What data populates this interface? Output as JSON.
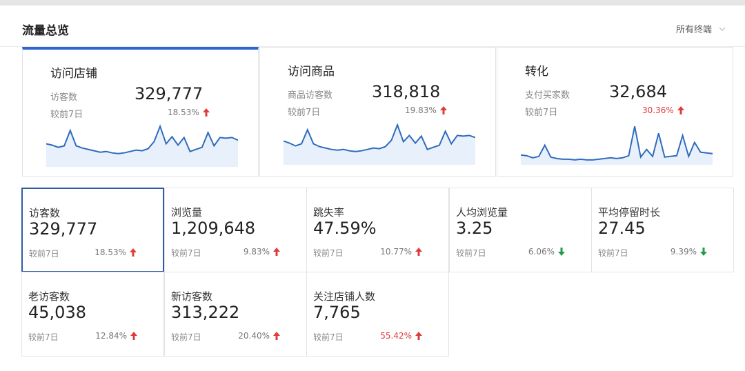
{
  "header": {
    "title": "流量总览",
    "filter_value": "所有终端"
  },
  "colors": {
    "accent": "#2e67d1",
    "up": "#e03b3b",
    "down": "#23994a",
    "chart_line": "#2f6bbd",
    "chart_fill": "#e8f0fb"
  },
  "panels": [
    {
      "title": "访问店铺",
      "sublabel": "访客数",
      "value": "329,777",
      "compare_label": "较前7日",
      "change": "18.53%",
      "direction": "up",
      "highlight": false,
      "trend": [
        33,
        31,
        28,
        30,
        52,
        30,
        27,
        25,
        23,
        21,
        22,
        20,
        19,
        20,
        22,
        24,
        23,
        26,
        36,
        58,
        33,
        43,
        31,
        42,
        22,
        25,
        28,
        49,
        30,
        42,
        41,
        42,
        38
      ]
    },
    {
      "title": "访问商品",
      "sublabel": "商品访客数",
      "value": "318,818",
      "compare_label": "较前7日",
      "change": "19.83%",
      "direction": "up",
      "highlight": false,
      "trend": [
        34,
        31,
        27,
        30,
        50,
        30,
        26,
        24,
        22,
        21,
        22,
        20,
        19,
        20,
        22,
        24,
        23,
        26,
        35,
        57,
        33,
        42,
        31,
        41,
        22,
        25,
        28,
        48,
        30,
        42,
        41,
        42,
        39
      ]
    },
    {
      "title": "转化",
      "sublabel": "支付买家数",
      "value": "32,684",
      "compare_label": "较前7日",
      "change": "30.36%",
      "direction": "up",
      "highlight": true,
      "trend": [
        14,
        13,
        10,
        12,
        28,
        11,
        9,
        8,
        8,
        7,
        8,
        7,
        7,
        8,
        9,
        10,
        9,
        10,
        13,
        55,
        11,
        22,
        12,
        45,
        11,
        12,
        13,
        42,
        12,
        32,
        18,
        17,
        16
      ]
    }
  ],
  "metrics": [
    {
      "label": "访客数",
      "value": "329,777",
      "compare_label": "较前7日",
      "change": "18.53%",
      "direction": "up",
      "highlight": false,
      "selected": true
    },
    {
      "label": "浏览量",
      "value": "1,209,648",
      "compare_label": "较前7日",
      "change": "9.83%",
      "direction": "up",
      "highlight": false,
      "selected": false
    },
    {
      "label": "跳失率",
      "value": "47.59%",
      "compare_label": "较前7日",
      "change": "10.77%",
      "direction": "up",
      "highlight": false,
      "selected": false
    },
    {
      "label": "人均浏览量",
      "value": "3.25",
      "compare_label": "较前7日",
      "change": "6.06%",
      "direction": "down",
      "highlight": false,
      "selected": false
    },
    {
      "label": "平均停留时长",
      "value": "27.45",
      "compare_label": "较前7日",
      "change": "9.39%",
      "direction": "down",
      "highlight": false,
      "selected": false
    },
    {
      "label": "老访客数",
      "value": "45,038",
      "compare_label": "较前7日",
      "change": "12.84%",
      "direction": "up",
      "highlight": false,
      "selected": false
    },
    {
      "label": "新访客数",
      "value": "313,222",
      "compare_label": "较前7日",
      "change": "20.40%",
      "direction": "up",
      "highlight": false,
      "selected": false
    },
    {
      "label": "关注店铺人数",
      "value": "7,765",
      "compare_label": "较前7日",
      "change": "55.42%",
      "direction": "up",
      "highlight": true,
      "selected": false
    }
  ]
}
